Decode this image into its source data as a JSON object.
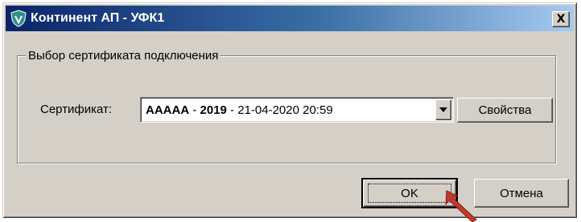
{
  "window": {
    "title": "Континент АП - УФК1",
    "close_glyph": "X",
    "app_icon": "shield-icon"
  },
  "group": {
    "legend": "Выбор сертификата подключения"
  },
  "certificate": {
    "label": "Сертификат:",
    "selected": {
      "name": "AAAAA",
      "sep1": " - ",
      "year": "2019",
      "sep2": " - ",
      "date": "21-04-2020 20:59"
    },
    "dropdown_icon": "chevron-down-icon",
    "properties_button": "Свойства"
  },
  "footer": {
    "ok_button": "OK",
    "cancel_button": "Отмена"
  },
  "colors": {
    "dialog_face": "#d4d0c8",
    "title_gradient_start": "#0a246a",
    "title_gradient_end": "#a6caf0",
    "pointer_arrow": "#c0392b"
  }
}
